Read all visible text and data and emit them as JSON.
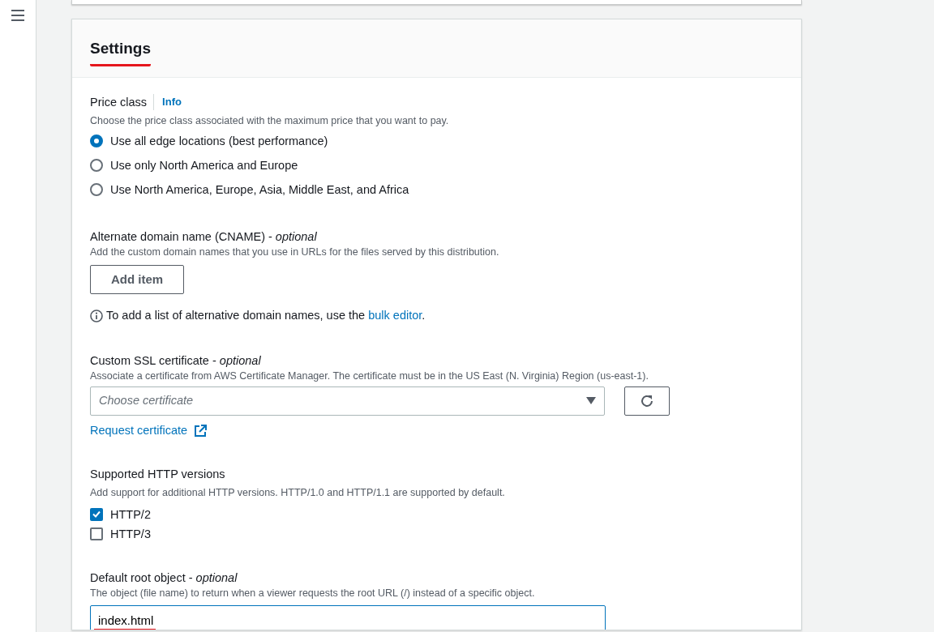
{
  "settings": {
    "title": "Settings",
    "annotated": true
  },
  "price_class": {
    "label": "Price class",
    "info": "Info",
    "description": "Choose the price class associated with the maximum price that you want to pay.",
    "options": [
      {
        "label": "Use all edge locations (best performance)",
        "selected": true
      },
      {
        "label": "Use only North America and Europe",
        "selected": false
      },
      {
        "label": "Use North America, Europe, Asia, Middle East, and Africa",
        "selected": false
      }
    ]
  },
  "cname": {
    "label": "Alternate domain name (CNAME) - *optional*",
    "description": "Add the custom domain names that you use in URLs for the files served by this distribution.",
    "button": "Add item",
    "note_before": "To add a list of alternative domain names, use the ",
    "note_link": "bulk editor",
    "note_after": "."
  },
  "ssl": {
    "label": "Custom SSL certificate - *optional*",
    "description": "Associate a certificate from AWS Certificate Manager. The certificate must be in the US East (N. Virginia) Region (us-east-1).",
    "placeholder": "Choose certificate",
    "link": "Request certificate"
  },
  "http": {
    "label": "Supported HTTP versions",
    "description": "Add support for additional HTTP versions. HTTP/1.0 and HTTP/1.1 are supported by default.",
    "options": [
      {
        "label": "HTTP/2",
        "checked": true
      },
      {
        "label": "HTTP/3",
        "checked": false
      }
    ]
  },
  "root": {
    "label": "Default root object - *optional*",
    "description": "The object (file name) to return when a viewer requests the root URL (/) instead of a specific object.",
    "value": "index.html",
    "annotated": true
  }
}
